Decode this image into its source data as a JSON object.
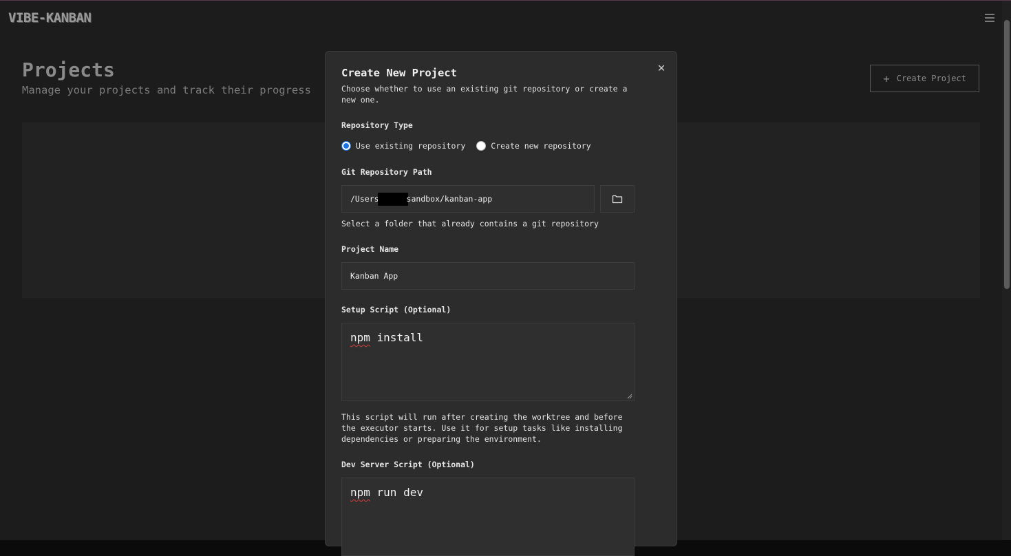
{
  "app": {
    "logo": "VIBE-KANBAN",
    "menu_icon": "hamburger-menu-icon"
  },
  "page": {
    "title": "Projects",
    "subtitle": "Manage your projects and track their progress",
    "create_button_label": "Create Project",
    "create_button_icon": "plus-icon"
  },
  "modal": {
    "title": "Create New Project",
    "description": "Choose whether to use an existing git repository or create a new one.",
    "close_icon": "close-icon",
    "repo_type": {
      "label": "Repository Type",
      "options": [
        "Use existing repository",
        "Create new repository"
      ],
      "selected": "Use existing repository"
    },
    "git_path": {
      "label": "Git Repository Path",
      "value_prefix": "/Users",
      "value_suffix": "sandbox/kanban-app",
      "browse_icon": "folder-icon",
      "help": "Select a folder that already contains a git repository"
    },
    "project_name": {
      "label": "Project Name",
      "value": "Kanban App"
    },
    "setup_script": {
      "label": "Setup Script (Optional)",
      "value_word1": "npm",
      "value_rest": " install",
      "help": "This script will run after creating the worktree and before the executor starts. Use it for setup tasks like installing dependencies or preparing the environment."
    },
    "dev_script": {
      "label": "Dev Server Script (Optional)",
      "value_word1": "npm",
      "value_rest": " run dev"
    }
  },
  "colors": {
    "radio_selected": "#1a73e8",
    "modal_bg": "#2c2c2c",
    "page_bg": "#1c1c1c"
  }
}
